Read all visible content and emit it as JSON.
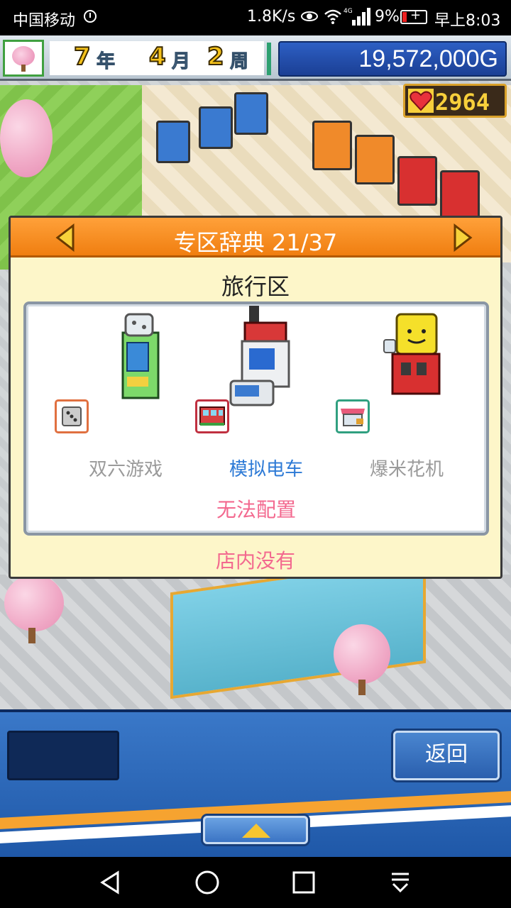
{
  "status_bar": {
    "carrier": "中国移动",
    "speed": "1.8K/s",
    "battery_pct": "9%",
    "time": "早上8:03"
  },
  "hud": {
    "year": "7",
    "year_unit": "年",
    "month": "4",
    "month_unit": "月",
    "week": "2",
    "week_unit": "周",
    "money": "19,572,000G",
    "hearts": "2964"
  },
  "dialog": {
    "title": "专区辞典 21/37",
    "zone_name": "旅行区",
    "items": [
      {
        "label": "双六游戏",
        "color": "#9a9a9a"
      },
      {
        "label": "模拟电车",
        "color": "#2d7ad6"
      },
      {
        "label": "爆米花机",
        "color": "#9a9a9a"
      }
    ],
    "status_placement": "无法配置",
    "status_store": "店内没有"
  },
  "bottom": {
    "back_label": "返回"
  },
  "colors": {
    "dialog_header": "#f07e10",
    "dialog_bg": "#fdf6c9",
    "accent_pink": "#f3698f",
    "money_bg": "#1b3f94"
  }
}
